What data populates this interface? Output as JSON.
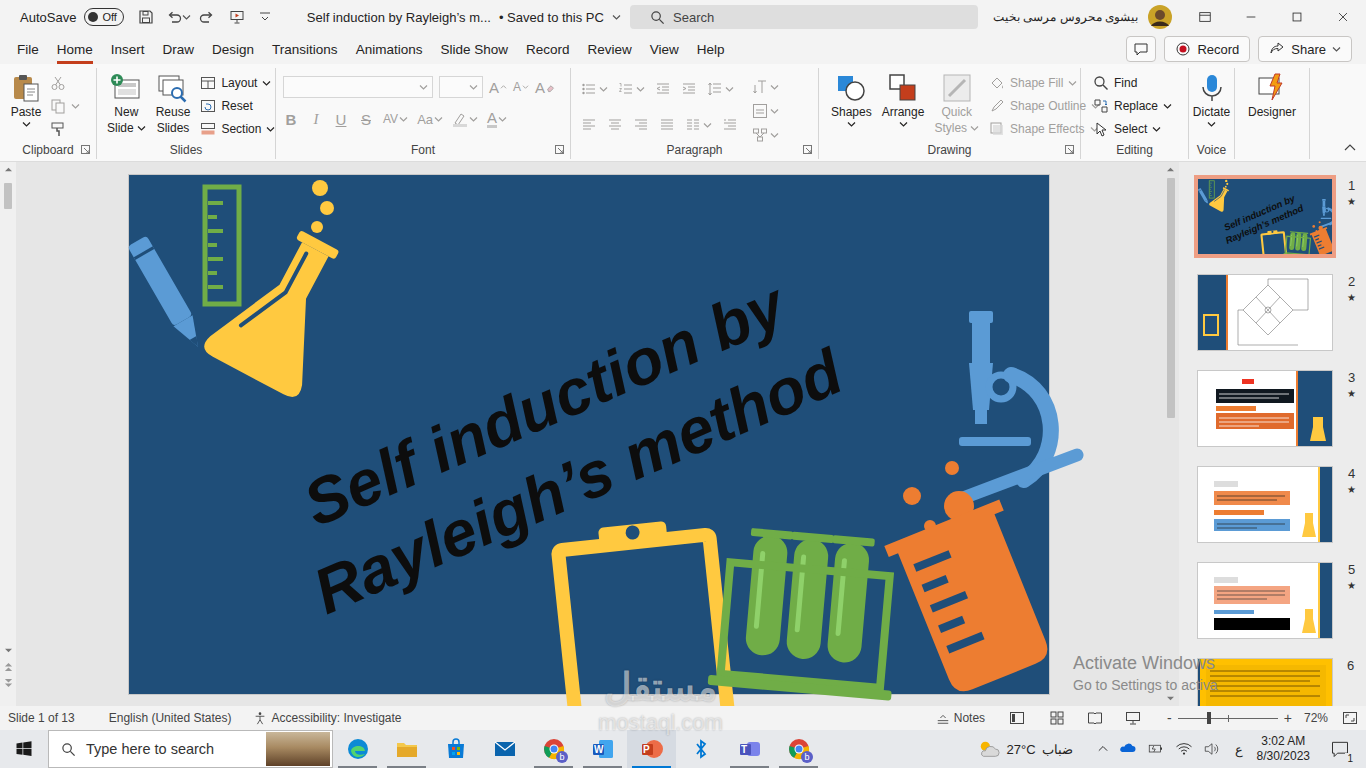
{
  "titlebar": {
    "autosave": "AutoSave",
    "autosave_toggle": {
      "label": "Off",
      "on": false
    },
    "title": "Self induction by Rayleigh’s m...",
    "save_status": "• Saved to this PC",
    "search": {
      "placeholder": "Search"
    },
    "user": "بيشوى محروس مرسى بخيت"
  },
  "ribbon": {
    "tabs": [
      {
        "label": "File",
        "selected": false
      },
      {
        "label": "Home",
        "selected": true
      },
      {
        "label": "Insert",
        "selected": false
      },
      {
        "label": "Draw",
        "selected": false
      },
      {
        "label": "Design",
        "selected": false
      },
      {
        "label": "Transitions",
        "selected": false
      },
      {
        "label": "Animations",
        "selected": false
      },
      {
        "label": "Slide Show",
        "selected": false
      },
      {
        "label": "Record",
        "selected": false
      },
      {
        "label": "Review",
        "selected": false
      },
      {
        "label": "View",
        "selected": false
      },
      {
        "label": "Help",
        "selected": false
      }
    ],
    "record_button": "Record",
    "share_button": "Share",
    "clipboard": {
      "label": "Clipboard",
      "paste": "Paste",
      "cut_disabled": true,
      "copy_disabled": true
    },
    "slides": {
      "label": "Slides",
      "new_slide": [
        "New",
        "Slide"
      ],
      "reuse_slides": [
        "Reuse",
        "Slides"
      ],
      "layout": "Layout",
      "reset": "Reset",
      "section": "Section"
    },
    "font": {
      "label": "Font",
      "disabled": true,
      "row1": [
        {
          "kind": "grow",
          "text": "A"
        },
        {
          "kind": "shrink",
          "text": "A"
        },
        {
          "kind": "clear",
          "text": "A"
        }
      ],
      "row2": [
        {
          "kind": "bold",
          "text": "B"
        },
        {
          "kind": "italic",
          "text": "I"
        },
        {
          "kind": "underline",
          "text": "U"
        },
        {
          "kind": "strike",
          "text": "S"
        },
        {
          "kind": "spacing",
          "text": "AV"
        },
        {
          "kind": "case",
          "text": "Aa"
        },
        {
          "kind": "highlight",
          "text": ""
        },
        {
          "kind": "color",
          "text": "A"
        }
      ]
    },
    "paragraph": {
      "label": "Paragraph",
      "disabled": true
    },
    "drawing": {
      "label": "Drawing",
      "shapes": "Shapes",
      "arrange": "Arrange",
      "quick_styles": {
        "lines": [
          "Quick",
          "Styles"
        ],
        "disabled": true
      },
      "format": [
        {
          "label": "Shape Fill",
          "disabled": true
        },
        {
          "label": "Shape Outline",
          "disabled": true
        },
        {
          "label": "Shape Effects",
          "disabled": true
        }
      ]
    },
    "editing": {
      "label": "Editing",
      "items": [
        {
          "label": "Find",
          "dropdown": false
        },
        {
          "label": "Replace",
          "dropdown": true
        },
        {
          "label": "Select",
          "dropdown": true
        }
      ]
    },
    "voice": {
      "label": "Voice",
      "dictate": "Dictate"
    },
    "designer": {
      "label": "Designer"
    }
  },
  "slide": {
    "title_lines": [
      "Self induction by",
      "Rayleigh’s method"
    ]
  },
  "thumbnails": [
    {
      "number": "1",
      "mark": "★",
      "selected": true,
      "kind": "title"
    },
    {
      "number": "2",
      "mark": "★",
      "selected": false,
      "kind": "diagram"
    },
    {
      "number": "3",
      "mark": "★",
      "selected": false,
      "kind": "text"
    },
    {
      "number": "4",
      "mark": "★",
      "selected": false,
      "kind": "text-blue"
    },
    {
      "number": "5",
      "mark": "★",
      "selected": false,
      "kind": "text-dark"
    },
    {
      "number": "6",
      "mark": "",
      "selected": false,
      "kind": "yellow"
    }
  ],
  "status_bar": {
    "slide_count": "Slide 1 of 13",
    "language": "English (United States)",
    "accessibility": "Accessibility: Investigate",
    "notes": "Notes",
    "zoom": {
      "minus": "-",
      "plus": "+",
      "level": 0.31,
      "label": "72%"
    }
  },
  "taskbar": {
    "search_placeholder": "Type here to search",
    "apps": [
      {
        "running": true,
        "active": false,
        "letter": "",
        "badge": ""
      },
      {
        "running": true,
        "active": false,
        "letter": "",
        "badge": ""
      },
      {
        "running": false,
        "active": false,
        "letter": "",
        "badge": ""
      },
      {
        "running": false,
        "active": false,
        "letter": "",
        "badge": ""
      },
      {
        "running": true,
        "active": false,
        "letter": "",
        "badge": "b"
      },
      {
        "running": true,
        "active": false,
        "letter": "W",
        "badge": ""
      },
      {
        "running": true,
        "active": true,
        "letter": "P",
        "badge": ""
      },
      {
        "running": false,
        "active": false,
        "letter": "",
        "badge": ""
      },
      {
        "running": true,
        "active": false,
        "letter": "T",
        "badge": ""
      },
      {
        "running": true,
        "active": false,
        "letter": "",
        "badge": "b"
      }
    ],
    "weather": {
      "temp": "27°C",
      "text": "ضباب"
    },
    "language": "ع",
    "time": "3:02 AM",
    "date": "8/30/2023",
    "notifications": "1"
  },
  "watermarks": {
    "activate": {
      "title": "Activate Windows",
      "hint": "Go to Settings to activa"
    },
    "site": {
      "arabic": "مستقل",
      "latin": "mostaql.com"
    }
  }
}
